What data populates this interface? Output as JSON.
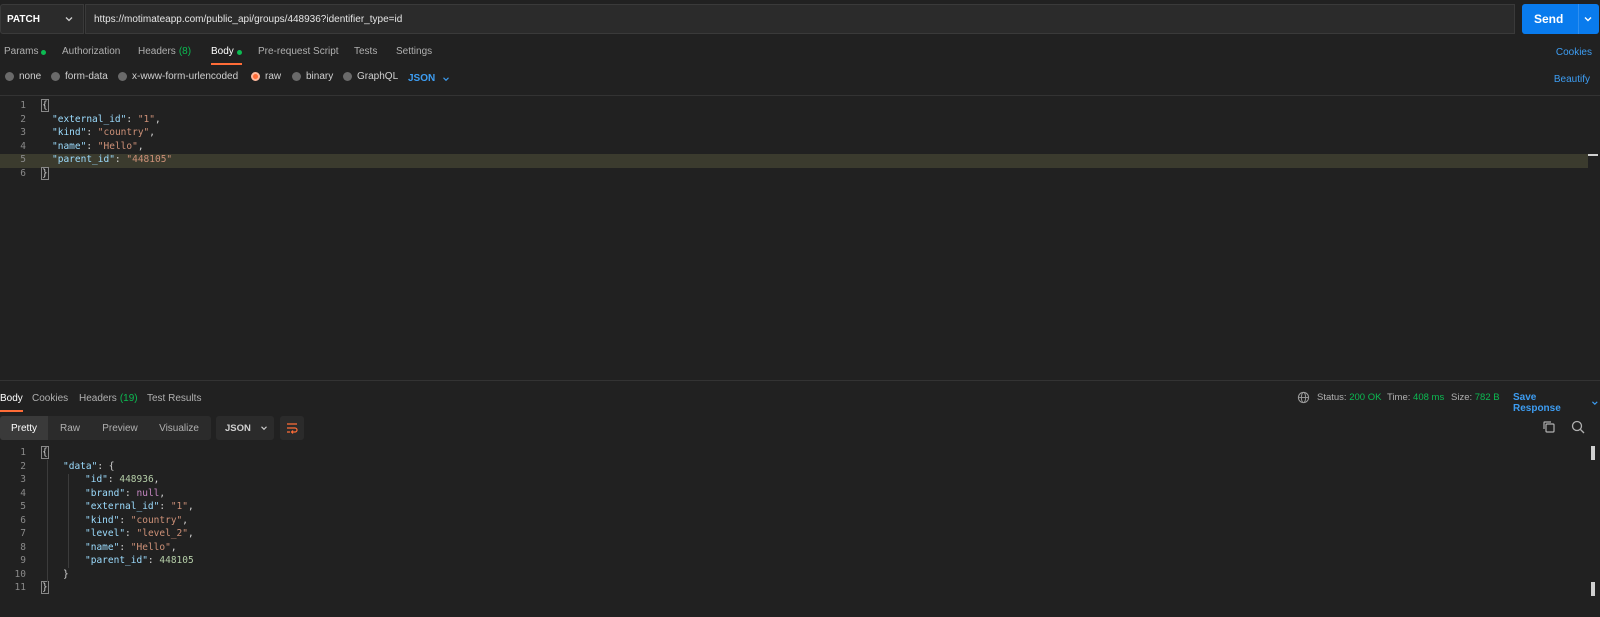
{
  "request": {
    "method": "PATCH",
    "url": "https://motimateapp.com/public_api/groups/448936?identifier_type=id",
    "send_label": "Send"
  },
  "request_tabs": {
    "params": "Params",
    "authorization": "Authorization",
    "headers": "Headers",
    "headers_count": "(8)",
    "body": "Body",
    "pre_request": "Pre-request Script",
    "tests": "Tests",
    "settings": "Settings",
    "cookies": "Cookies"
  },
  "body_types": {
    "none": "none",
    "form_data": "form-data",
    "urlencoded": "x-www-form-urlencoded",
    "raw": "raw",
    "binary": "binary",
    "graphql": "GraphQL",
    "selected_format": "JSON",
    "beautify": "Beautify"
  },
  "request_body": {
    "line_numbers": [
      "1",
      "2",
      "3",
      "4",
      "5",
      "6"
    ],
    "open_brace": "{",
    "close_brace": "}",
    "k1": "\"external_id\"",
    "v1": "\"1\"",
    "k2": "\"kind\"",
    "v2": "\"country\"",
    "k3": "\"name\"",
    "v3": "\"Hello\"",
    "k4": "\"parent_id\"",
    "v4": "\"448105\""
  },
  "response_tabs": {
    "body": "Body",
    "cookies": "Cookies",
    "headers": "Headers",
    "headers_count": "(19)",
    "test_results": "Test Results"
  },
  "response_status": {
    "status_label": "Status:",
    "status_value": "200 OK",
    "time_label": "Time:",
    "time_value": "408 ms",
    "size_label": "Size:",
    "size_value": "782 B",
    "save_response": "Save Response"
  },
  "response_view": {
    "pretty": "Pretty",
    "raw": "Raw",
    "preview": "Preview",
    "visualize": "Visualize",
    "format": "JSON"
  },
  "response_body": {
    "line_numbers": [
      "1",
      "2",
      "3",
      "4",
      "5",
      "6",
      "7",
      "8",
      "9",
      "10",
      "11"
    ],
    "open_brace": "{",
    "close_brace": "}",
    "data_key": "\"data\"",
    "id_key": "\"id\"",
    "id_val": "448936",
    "brand_key": "\"brand\"",
    "brand_val": "null",
    "ext_key": "\"external_id\"",
    "ext_val": "\"1\"",
    "kind_key": "\"kind\"",
    "kind_val": "\"country\"",
    "level_key": "\"level\"",
    "level_val": "\"level_2\"",
    "name_key": "\"name\"",
    "name_val": "\"Hello\"",
    "parent_key": "\"parent_id\"",
    "parent_val": "448105",
    "inner_close": "}"
  },
  "colors": {
    "accent_orange": "#ff6c37",
    "link_blue": "#3d9df2",
    "send_blue": "#097bed",
    "success_green": "#0cbb52"
  }
}
